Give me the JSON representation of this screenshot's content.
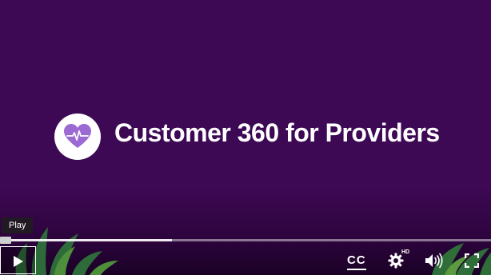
{
  "video": {
    "title": "Customer 360 for Providers",
    "background_color": "#3d0854",
    "logo_icon": "heart-pulse-icon",
    "logo_colors": {
      "circle": "#ffffff",
      "heart": "#9b6ad3"
    }
  },
  "controls": {
    "tooltip": "Play",
    "play_icon": "play-icon",
    "cc_label": "CC",
    "hd_badge": "HD",
    "settings_icon": "gear-icon",
    "volume_icon": "volume-icon",
    "fullscreen_icon": "fullscreen-icon",
    "progress": {
      "played_fraction": 0.0,
      "buffered_fraction": 0.35
    }
  }
}
